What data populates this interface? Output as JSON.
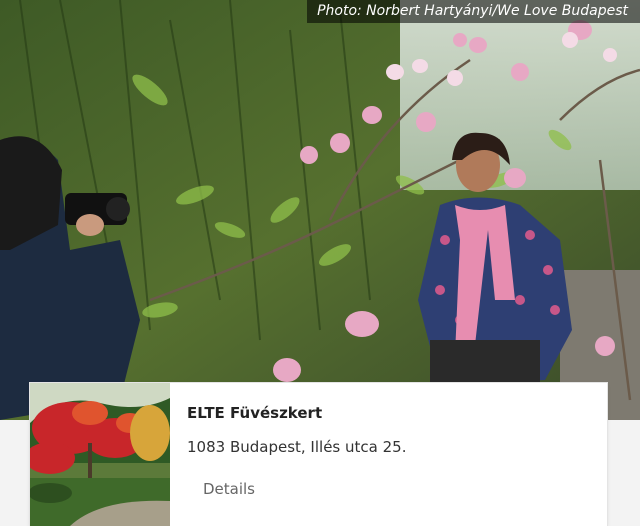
{
  "hero": {
    "credit": "Photo: Norbert Hartyányi/We Love Budapest"
  },
  "place_card": {
    "title": "ELTE Füvészkert",
    "address": "1083 Budapest, Illés utca 25.",
    "details_label": "Details"
  },
  "colors": {
    "foliage_dark": "#2f4a1e",
    "foliage_light": "#8fbf4a",
    "magnolia_pink": "#e7a8c4",
    "maple_red": "#c8262a",
    "card_bg": "#ffffff"
  }
}
